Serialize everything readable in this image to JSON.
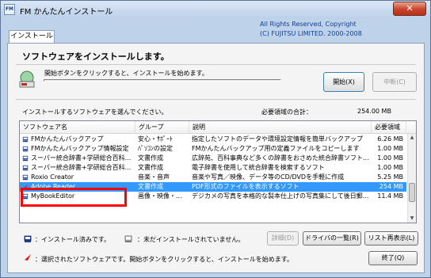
{
  "window": {
    "title": "FM かんたんインストール",
    "close_glyph": "✕"
  },
  "copyright": {
    "line1": "All Rights Reserved, Copyright",
    "line2": "(C) FUJITSU LIMITED.  2000-2008"
  },
  "tab": {
    "label": "インストール"
  },
  "heading": "ソフトウェアをインストールします。",
  "instruction": "開始ボタンをクリックすると、インストールを始めます。",
  "progress": 0,
  "buttons": {
    "start": "開始(X)",
    "stop": "中断(C)",
    "detail": "詳細(D)",
    "driver_list": "ドライバの一覧(R)",
    "refresh": "リスト再表示(L)",
    "exit": "終了(Q)"
  },
  "select_prompt": "インストールするソフトウェアを選んでください。",
  "total": {
    "label": "必要領域の合計：",
    "value": "254.00 MB"
  },
  "list": {
    "columns": [
      "ソフトウェア名",
      "グループ",
      "説明",
      "必要領域"
    ],
    "rows": [
      {
        "name": "FMかんたんバックアップ",
        "group": "安心・ｻﾎﾟｰﾄ",
        "desc": "指定したソフトのデータや環境設定情報を簡単バックアップ",
        "size": "6.26 MB",
        "status": "installed"
      },
      {
        "name": "FMかんたんバックアップ情報設定",
        "group": "ﾊﾟｿｺﾝの設定",
        "desc": "FMかんたんバックアップ用の定義ファイルをコピーします",
        "size": "1.00 MB",
        "status": "installed"
      },
      {
        "name": "スーパー統合辞書+学研総合百科...",
        "group": "文書作成",
        "desc": "広辞苑、百科事典など多くの辞書をおさめた統合辞書ソフト...",
        "size": "1.00 MB",
        "status": "installed"
      },
      {
        "name": "スーパー統合辞書+学研総合百科...",
        "group": "文書作成",
        "desc": "電子辞書を使用して統合辞書を検索するソフト",
        "size": "1.00 MB",
        "status": "installed"
      },
      {
        "name": "Roxio Creator",
        "group": "音楽・音声",
        "desc": "音楽や写真／映像、データ等のCD/DVDを手軽に作成",
        "size": "5.25 MB",
        "status": "installed"
      },
      {
        "name": "Adobe Reader",
        "group": "文書作成",
        "desc": "PDF形式のファイルを表示するソフト",
        "size": "254 MB",
        "status": "selected"
      },
      {
        "name": "MyBookEditor",
        "group": "画像・映像・...",
        "desc": "デジカメの写真を本格的な製本仕上げの写真集にして後日郵...",
        "size": "11.4 MB",
        "status": "installed"
      }
    ]
  },
  "legend": {
    "installed": "：インストール済みです。",
    "not_installed": "：未だインストールされていません。",
    "selected": "：選択されたソフトウェアです。開始ボタンをクリックすると、インストールを始めます。"
  },
  "colors": {
    "selection": "#3399ff",
    "highlight": "#ff0000",
    "copyright": "#0f3f9e"
  }
}
